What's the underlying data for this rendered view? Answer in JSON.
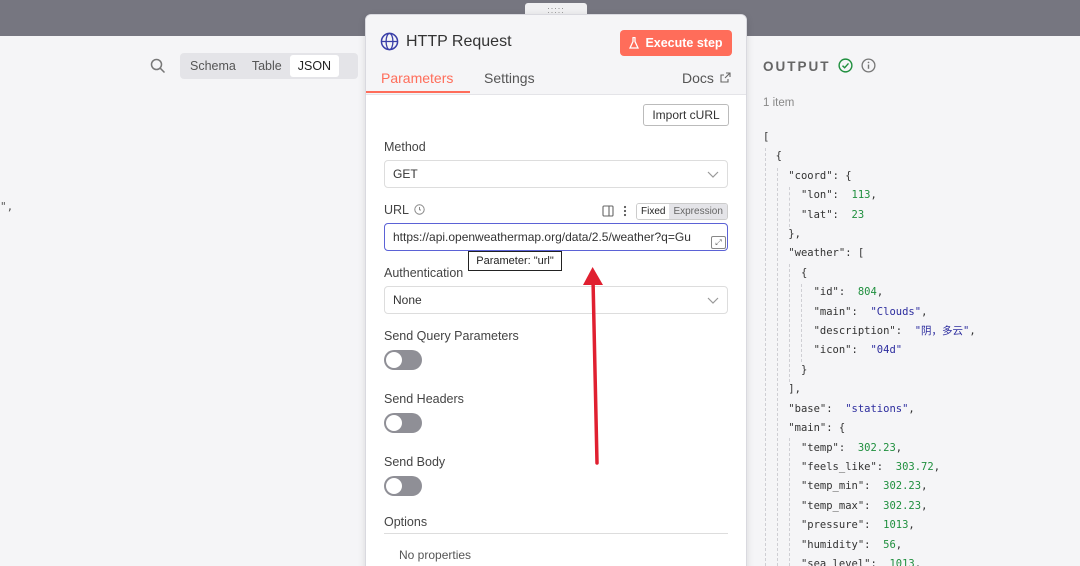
{
  "left": {
    "view_tabs": [
      "Schema",
      "Table",
      "JSON"
    ],
    "active_view": "JSON",
    "stray_text": "\","
  },
  "panel": {
    "drag_handle": ":::::",
    "title": "HTTP Request",
    "execute_label": "Execute step",
    "tabs": {
      "parameters": "Parameters",
      "settings": "Settings",
      "docs": "Docs"
    },
    "import_curl": "Import cURL",
    "method_label": "Method",
    "method_value": "GET",
    "url_label": "URL",
    "url_mode_fixed": "Fixed",
    "url_mode_expression": "Expression",
    "url_value": "https://api.openweathermap.org/data/2.5/weather?q=Gu",
    "url_tooltip": "Parameter: \"url\"",
    "auth_label": "Authentication",
    "auth_value": "None",
    "send_query_label": "Send Query Parameters",
    "send_query_on": false,
    "send_headers_label": "Send Headers",
    "send_headers_on": false,
    "send_body_label": "Send Body",
    "send_body_on": false,
    "options_label": "Options",
    "no_properties": "No properties"
  },
  "output": {
    "title": "OUTPUT",
    "item_count": "1 item",
    "json_lines": [
      {
        "i": 0,
        "t": [
          [
            "p",
            "["
          ]
        ]
      },
      {
        "i": 1,
        "t": [
          [
            "p",
            "{"
          ]
        ]
      },
      {
        "i": 2,
        "t": [
          [
            "k",
            "\"coord\""
          ],
          [
            "p",
            ": {"
          ]
        ]
      },
      {
        "i": 3,
        "t": [
          [
            "k",
            "\"lon\""
          ],
          [
            "p",
            ":  "
          ],
          [
            "n",
            "113"
          ],
          [
            "p",
            ","
          ]
        ]
      },
      {
        "i": 3,
        "t": [
          [
            "k",
            "\"lat\""
          ],
          [
            "p",
            ":  "
          ],
          [
            "n",
            "23"
          ]
        ]
      },
      {
        "i": 2,
        "t": [
          [
            "p",
            "},"
          ]
        ]
      },
      {
        "i": 2,
        "t": [
          [
            "k",
            "\"weather\""
          ],
          [
            "p",
            ": ["
          ]
        ]
      },
      {
        "i": 3,
        "t": [
          [
            "p",
            "{"
          ]
        ]
      },
      {
        "i": 4,
        "t": [
          [
            "k",
            "\"id\""
          ],
          [
            "p",
            ":  "
          ],
          [
            "n",
            "804"
          ],
          [
            "p",
            ","
          ]
        ]
      },
      {
        "i": 4,
        "t": [
          [
            "k",
            "\"main\""
          ],
          [
            "p",
            ":  "
          ],
          [
            "s",
            "\"Clouds\""
          ],
          [
            "p",
            ","
          ]
        ]
      },
      {
        "i": 4,
        "t": [
          [
            "k",
            "\"description\""
          ],
          [
            "p",
            ":  "
          ],
          [
            "s",
            "\"阴，多云\""
          ],
          [
            "p",
            ","
          ]
        ]
      },
      {
        "i": 4,
        "t": [
          [
            "k",
            "\"icon\""
          ],
          [
            "p",
            ":  "
          ],
          [
            "s",
            "\"04d\""
          ]
        ]
      },
      {
        "i": 3,
        "t": [
          [
            "p",
            "}"
          ]
        ]
      },
      {
        "i": 2,
        "t": [
          [
            "p",
            "],"
          ]
        ]
      },
      {
        "i": 2,
        "t": [
          [
            "k",
            "\"base\""
          ],
          [
            "p",
            ":  "
          ],
          [
            "s",
            "\"stations\""
          ],
          [
            "p",
            ","
          ]
        ]
      },
      {
        "i": 2,
        "t": [
          [
            "k",
            "\"main\""
          ],
          [
            "p",
            ": {"
          ]
        ]
      },
      {
        "i": 3,
        "t": [
          [
            "k",
            "\"temp\""
          ],
          [
            "p",
            ":  "
          ],
          [
            "n",
            "302.23"
          ],
          [
            "p",
            ","
          ]
        ]
      },
      {
        "i": 3,
        "t": [
          [
            "k",
            "\"feels_like\""
          ],
          [
            "p",
            ":  "
          ],
          [
            "n",
            "303.72"
          ],
          [
            "p",
            ","
          ]
        ]
      },
      {
        "i": 3,
        "t": [
          [
            "k",
            "\"temp_min\""
          ],
          [
            "p",
            ":  "
          ],
          [
            "n",
            "302.23"
          ],
          [
            "p",
            ","
          ]
        ]
      },
      {
        "i": 3,
        "t": [
          [
            "k",
            "\"temp_max\""
          ],
          [
            "p",
            ":  "
          ],
          [
            "n",
            "302.23"
          ],
          [
            "p",
            ","
          ]
        ]
      },
      {
        "i": 3,
        "t": [
          [
            "k",
            "\"pressure\""
          ],
          [
            "p",
            ":  "
          ],
          [
            "n",
            "1013"
          ],
          [
            "p",
            ","
          ]
        ]
      },
      {
        "i": 3,
        "t": [
          [
            "k",
            "\"humidity\""
          ],
          [
            "p",
            ":  "
          ],
          [
            "n",
            "56"
          ],
          [
            "p",
            ","
          ]
        ]
      },
      {
        "i": 3,
        "t": [
          [
            "k",
            "\"sea_level\""
          ],
          [
            "p",
            ":  "
          ],
          [
            "n",
            "1013"
          ],
          [
            "p",
            ","
          ]
        ]
      }
    ]
  },
  "colors": {
    "accent": "#ff6d5a",
    "url_border": "#5b62d6",
    "success": "#1f8f3e",
    "annotation_arrow": "#e02030"
  }
}
